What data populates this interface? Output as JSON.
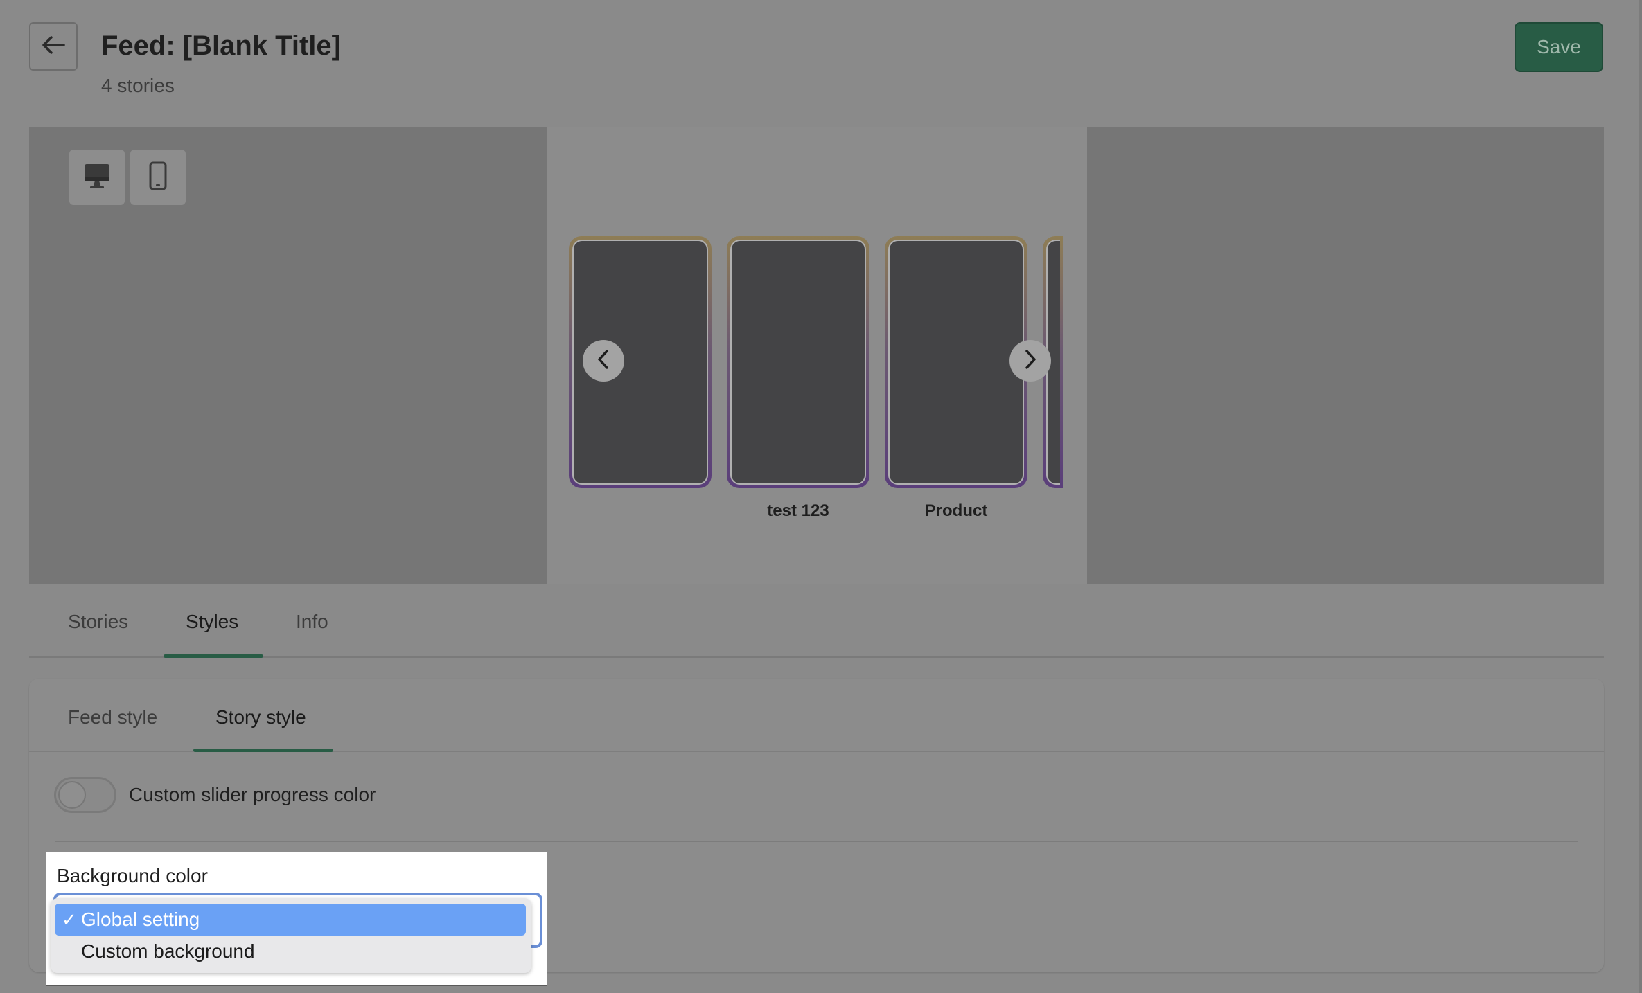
{
  "header": {
    "title": "Feed: [Blank Title]",
    "subtitle": "4 stories",
    "save_label": "Save"
  },
  "preview": {
    "device_modes": [
      "desktop-icon",
      "mobile-icon"
    ],
    "stories": [
      {
        "label": ""
      },
      {
        "label": "test 123"
      },
      {
        "label": "Product"
      },
      {
        "label": ""
      }
    ]
  },
  "tabs": {
    "items": [
      {
        "label": "Stories"
      },
      {
        "label": "Styles"
      },
      {
        "label": "Info"
      }
    ],
    "active": "Styles"
  },
  "subtabs": {
    "items": [
      {
        "label": "Feed style"
      },
      {
        "label": "Story style"
      }
    ],
    "active": "Story style"
  },
  "settings": {
    "custom_slider_progress_color_label": "Custom slider progress color",
    "custom_slider_progress_color_enabled": false,
    "background_color_label": "Background color",
    "background_options": [
      {
        "label": "Global setting",
        "selected": true
      },
      {
        "label": "Custom background",
        "selected": false
      }
    ],
    "check_mark": "✓"
  },
  "colors": {
    "accent": "#285c45",
    "selected_option": "#6aa1f5",
    "overlay_background": "#8a8a8a"
  }
}
